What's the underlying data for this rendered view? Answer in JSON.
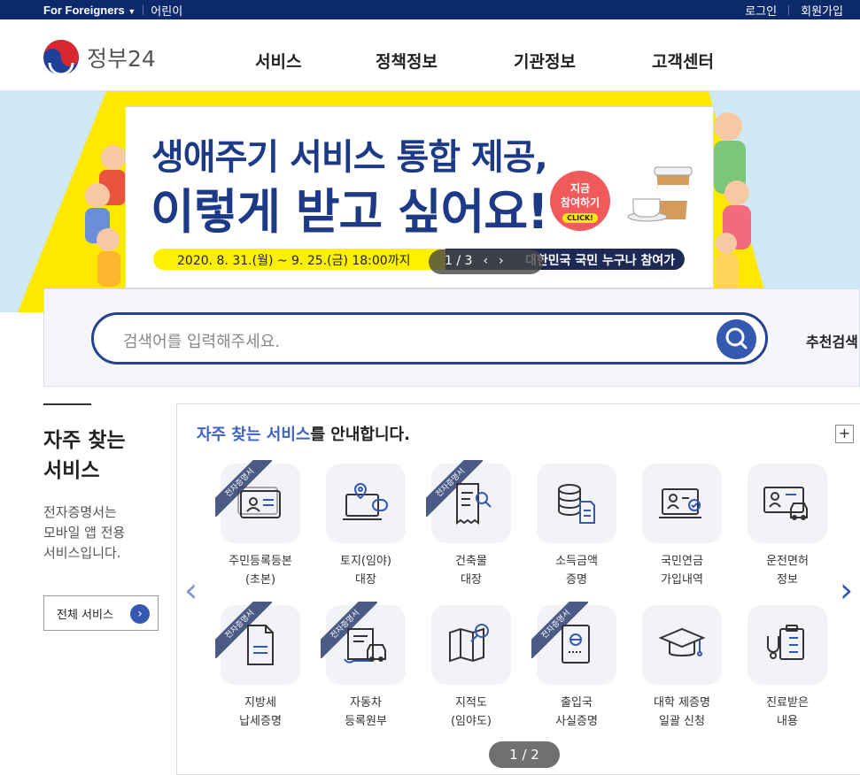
{
  "topbar": {
    "foreigners": "For Foreigners",
    "kids": "어린이",
    "login": "로그인",
    "signup": "회원가입"
  },
  "header": {
    "logo_text": "정부24",
    "nav": [
      "서비스",
      "정책정보",
      "기관정보",
      "고객센터"
    ]
  },
  "banner": {
    "title1": "생애주기 서비스 통합 제공,",
    "title2": "이렇게 받고 싶어요!",
    "date_text": "2020. 8. 31.(월) ~ 9. 25.(금) 18:00까지",
    "notice": "대한민국 국민 누구나 참여가능",
    "badge_line1": "지금",
    "badge_line2": "참여하기",
    "badge_click": "CLICK!",
    "counter": "1 / 3",
    "prev": "‹",
    "next": "›"
  },
  "search": {
    "placeholder": "검색어를 입력해주세요.",
    "recommend": "추천검색"
  },
  "sidebar": {
    "title_line1": "자주 찾는",
    "title_line2": "서비스",
    "desc_line1": "전자증명서는",
    "desc_line2": "모바일 앱 전용",
    "desc_line3": "서비스입니다.",
    "all_button": "전체 서비스",
    "all_arrow": "›"
  },
  "main": {
    "heading_highlight": "자주 찾는 서비스",
    "heading_rest": "를 안내합니다.",
    "plus": "+",
    "tag": "전자증명서",
    "pager": "1 / 2",
    "prev": "‹",
    "next": "›",
    "services": [
      {
        "l1": "주민등록등본",
        "l2": "(초본)",
        "icon": "id-card-icon"
      },
      {
        "l1": "토지(임야)",
        "l2": "대장",
        "icon": "map-pin-laptop-icon"
      },
      {
        "l1": "건축물",
        "l2": "대장",
        "icon": "document-search-icon"
      },
      {
        "l1": "소득금액",
        "l2": "증명",
        "icon": "database-document-icon"
      },
      {
        "l1": "국민연금",
        "l2": "가입내역",
        "icon": "pension-laptop-icon"
      },
      {
        "l1": "운전면허",
        "l2": "정보",
        "icon": "license-car-icon"
      },
      {
        "l1": "지방세",
        "l2": "납세증명",
        "icon": "tax-document-icon"
      },
      {
        "l1": "자동차",
        "l2": "등록원부",
        "icon": "car-register-icon"
      },
      {
        "l1": "지적도",
        "l2": "(임야도)",
        "icon": "map-magnifier-icon"
      },
      {
        "l1": "출입국",
        "l2": "사실증명",
        "icon": "passport-icon"
      },
      {
        "l1": "대학 제증명",
        "l2": "일괄 신청",
        "icon": "graduation-cap-icon"
      },
      {
        "l1": "진료받은",
        "l2": "내용",
        "icon": "medical-clipboard-icon"
      }
    ]
  },
  "colors": {
    "navy": "#0c2a6b",
    "accent": "#3558b0",
    "banner_yellow": "#ffe800"
  }
}
